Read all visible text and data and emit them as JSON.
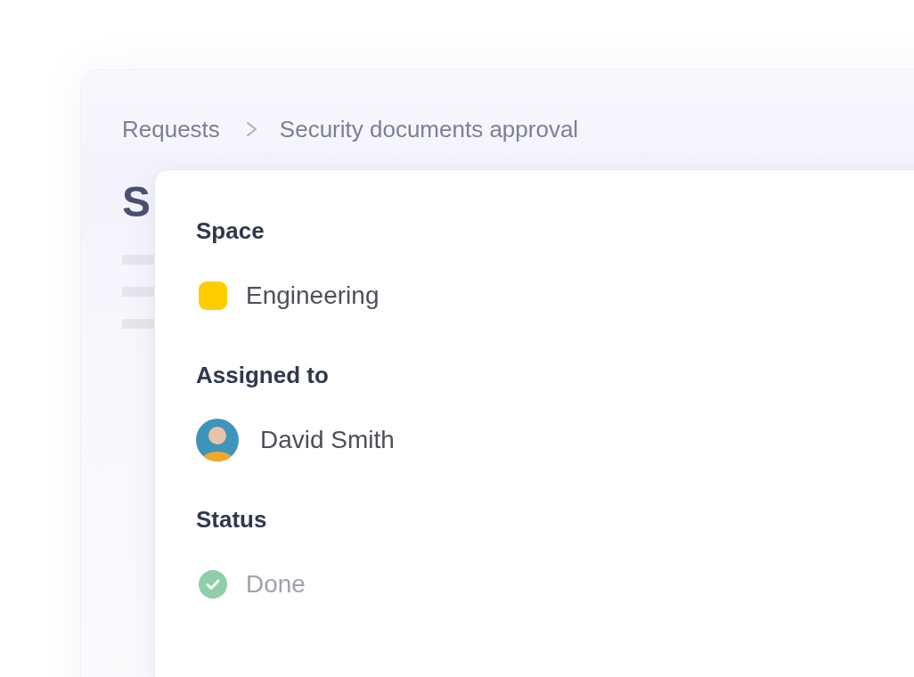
{
  "breadcrumb": [
    {
      "label": "Requests"
    },
    {
      "label": "Security documents approval"
    }
  ],
  "page": {
    "title": "S"
  },
  "details": [
    {
      "kind": "space",
      "label": "Space",
      "value": "Engineering",
      "color": "#ffcc00"
    },
    {
      "kind": "person",
      "label": "Assigned to",
      "value": "David Smith"
    },
    {
      "kind": "status",
      "label": "Status",
      "value": "Done"
    }
  ]
}
